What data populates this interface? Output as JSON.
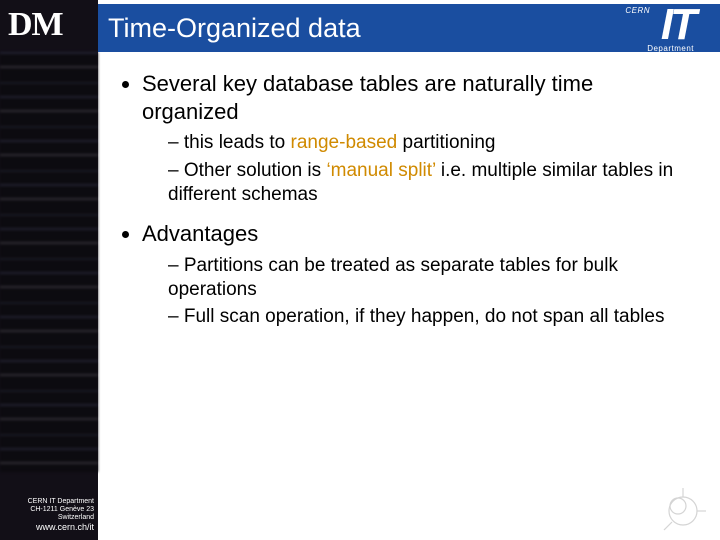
{
  "logo_dm": "DM",
  "title": "Time-Organized data",
  "it_logo": {
    "cern": "CERN",
    "it": "IT",
    "dep": "Department"
  },
  "bullets": {
    "b1_1": "Several key database tables are naturally time organized",
    "b1_1_sub1_pre": "this leads to ",
    "b1_1_sub1_hl": "range-based",
    "b1_1_sub1_post": " partitioning",
    "b1_1_sub2_pre": "Other solution is ",
    "b1_1_sub2_hl": "‘manual split’",
    "b1_1_sub2_post": " i.e. multiple similar tables in different schemas",
    "b1_2": "Advantages",
    "b1_2_sub1": "Partitions can be treated as separate tables for bulk operations",
    "b1_2_sub2": "Full scan operation, if they happen, do not span all tables"
  },
  "footer": {
    "l1": "CERN IT Department",
    "l2": "CH-1211 Genève 23",
    "l3": "Switzerland",
    "url": "www.cern.ch/it"
  }
}
